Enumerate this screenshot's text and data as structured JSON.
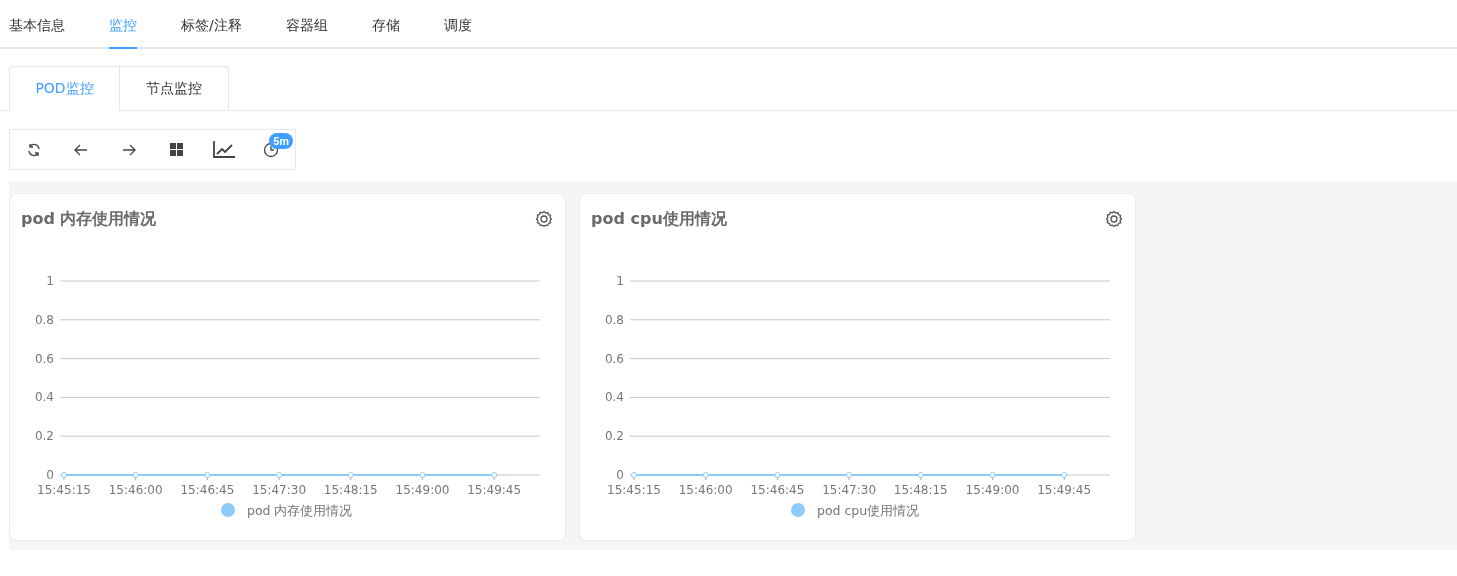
{
  "tabs": [
    {
      "label": "基本信息",
      "selected": false
    },
    {
      "label": "监控",
      "selected": true
    },
    {
      "label": "标签/注释",
      "selected": false
    },
    {
      "label": "容器组",
      "selected": false
    },
    {
      "label": "存储",
      "selected": false
    },
    {
      "label": "调度",
      "selected": false
    }
  ],
  "sub_tabs": [
    {
      "label": "POD监控",
      "selected": true
    },
    {
      "label": "节点监控",
      "selected": false
    }
  ],
  "toolbar": [
    {
      "kind": "refresh"
    },
    {
      "kind": "back"
    },
    {
      "kind": "forward"
    },
    {
      "kind": "grid"
    },
    {
      "kind": "chart"
    },
    {
      "kind": "clock",
      "badge": "5m"
    }
  ],
  "panels": [
    {
      "title": "pod 内存使用情况",
      "chart_data": {
        "type": "line",
        "grid": true,
        "x": [
          "15:45:15",
          "15:46:00",
          "15:46:45",
          "15:47:30",
          "15:48:15",
          "15:49:00",
          "15:49:45"
        ],
        "yticks": [
          0,
          0.2,
          0.4,
          0.6,
          0.8,
          1
        ],
        "ylim": [
          0,
          1
        ],
        "series": [
          {
            "name": "pod 内存使用情况",
            "color": "#8ecbfb",
            "marker": "circle",
            "values": [
              0,
              0,
              0,
              0,
              0,
              0,
              0
            ]
          }
        ]
      }
    },
    {
      "title": "pod cpu使用情况",
      "chart_data": {
        "type": "line",
        "grid": true,
        "x": [
          "15:45:15",
          "15:46:00",
          "15:46:45",
          "15:47:30",
          "15:48:15",
          "15:49:00",
          "15:49:45"
        ],
        "yticks": [
          0,
          0.2,
          0.4,
          0.6,
          0.8,
          1
        ],
        "ylim": [
          0,
          1
        ],
        "series": [
          {
            "name": "pod cpu使用情况",
            "color": "#8ecbfb",
            "marker": "circle",
            "values": [
              0,
              0,
              0,
              0,
              0,
              0,
              0
            ]
          }
        ]
      }
    }
  ]
}
